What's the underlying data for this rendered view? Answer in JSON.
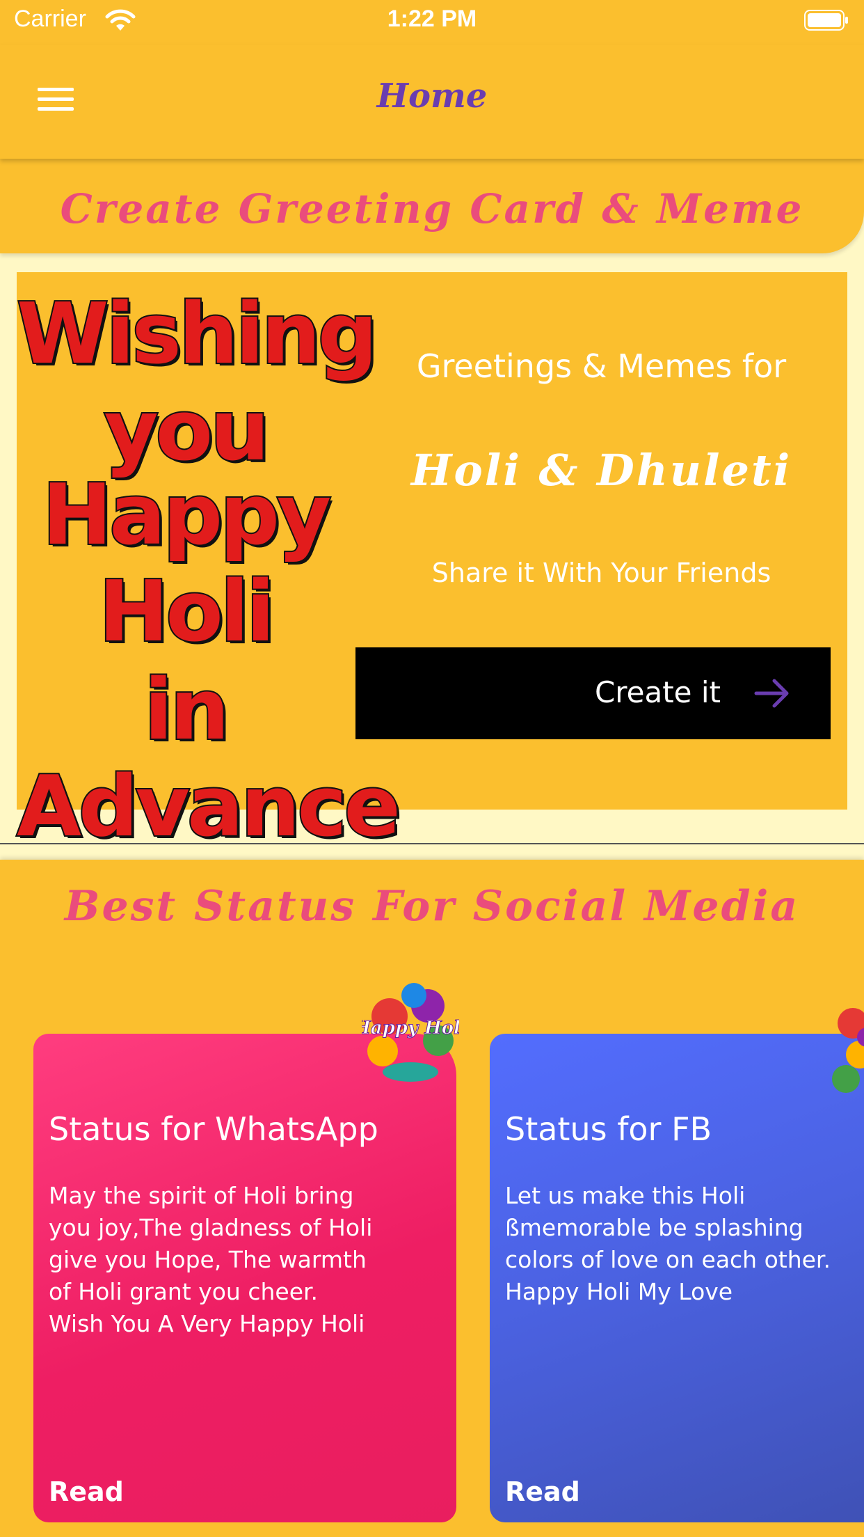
{
  "status_bar": {
    "carrier": "Carrier",
    "time": "1:22 PM"
  },
  "nav": {
    "title": "Home"
  },
  "section_greeting": {
    "title": "Create Greeting Card & Meme",
    "art_lines": [
      "Wishing you",
      "Happy Holi",
      "in Advance"
    ],
    "line1": "Greetings & Memes for",
    "line2": "Holi & Dhuleti",
    "line3": "Share it With Your Friends",
    "button_label": "Create it"
  },
  "section_status": {
    "title": "Best Status For Social Media",
    "cards": [
      {
        "title": "Status for WhatsApp",
        "text": "May the spirit of Holi bring\n you joy,The gladness of Holi\n give you Hope, The warmth\nof Holi grant you cheer.\nWish You A Very Happy Holi",
        "read_label": "Read"
      },
      {
        "title": "Status for FB",
        "text": "Let us make this Holi\nßmemorable be splashing\ncolors of love on each other.\nHappy Holi My Love",
        "read_label": "Read"
      }
    ],
    "sticker_text": "Happy Holi"
  },
  "colors": {
    "accent": "#FBBF2E",
    "title_pink": "#EA4C7C",
    "nav_purple": "#6A3DB0",
    "whatsapp_card": "#E91E63",
    "fb_card": "#536DFE"
  }
}
